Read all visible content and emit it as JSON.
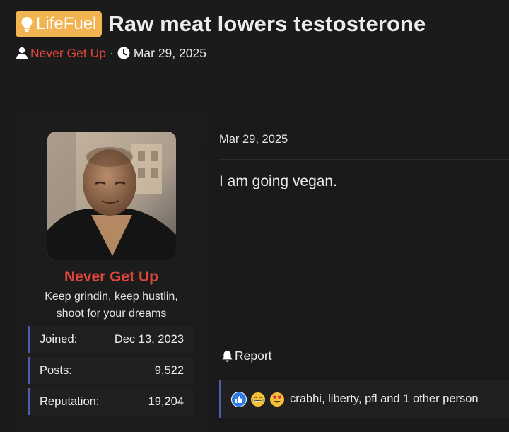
{
  "thread": {
    "prefix": "LifeFuel",
    "title": "Raw meat lowers testosterone",
    "author": "Never Get Up",
    "separator": "·",
    "date": "Mar 29, 2025"
  },
  "colors": {
    "prefix_badge": "#f2b451",
    "username": "#e0453b",
    "accent_border": "#4d5bb0",
    "background": "#1b1b1b"
  },
  "user": {
    "name": "Never Get Up",
    "title": "Keep grindin, keep hustlin, shoot for your dreams",
    "stats": [
      {
        "label": "Joined:",
        "value": "Dec 13, 2023"
      },
      {
        "label": "Posts:",
        "value": "9,522"
      },
      {
        "label": "Reputation:",
        "value": "19,204"
      }
    ]
  },
  "post": {
    "date": "Mar 29, 2025",
    "body": "I am going vegan.",
    "report_label": "Report",
    "reactions": {
      "icons": [
        "like-icon",
        "tears-of-joy-icon",
        "heart-eyes-icon"
      ],
      "text": "crabhi, liberty, pfl and 1 other person"
    }
  }
}
